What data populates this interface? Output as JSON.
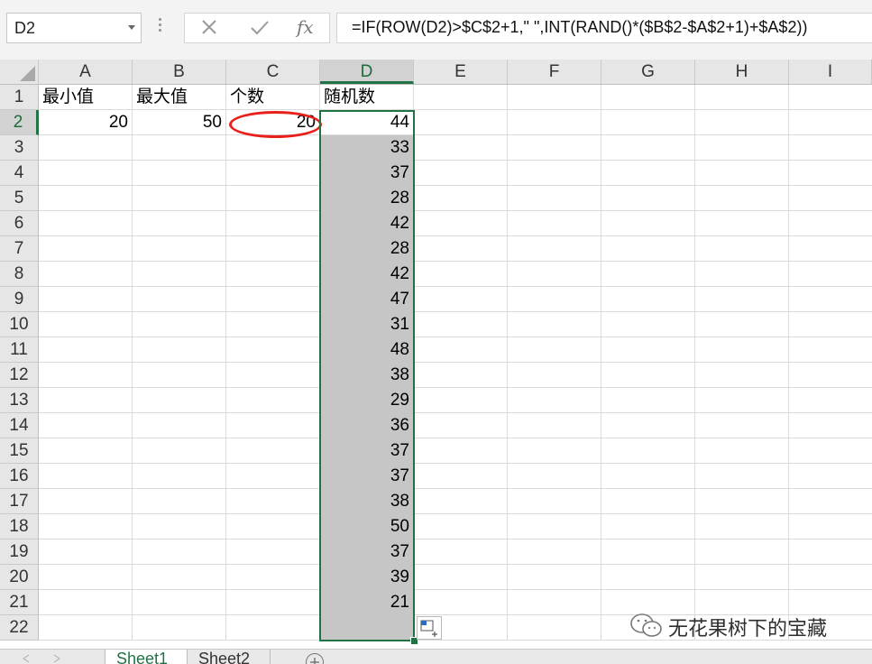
{
  "formula_bar": {
    "name_box": "D2",
    "formula": "=IF(ROW(D2)>$C$2+1,\" \",INT(RAND()*($B$2-$A$2+1)+$A$2))",
    "cancel_icon": "close-icon",
    "enter_icon": "checkmark-icon",
    "fx_label": "fx"
  },
  "columns": [
    "A",
    "B",
    "C",
    "D",
    "E",
    "F",
    "G",
    "H",
    "I"
  ],
  "rows": [
    "1",
    "2",
    "3",
    "4",
    "5",
    "6",
    "7",
    "8",
    "9",
    "10",
    "11",
    "12",
    "13",
    "14",
    "15",
    "16",
    "17",
    "18",
    "19",
    "20",
    "21",
    "22"
  ],
  "active_column": "D",
  "active_row": "2",
  "headers": {
    "A1": "最小值",
    "B1": "最大值",
    "C1": "个数",
    "D1": "随机数"
  },
  "values": {
    "A2": "20",
    "B2": "50",
    "C2": "20"
  },
  "random_numbers": [
    "44",
    "33",
    "37",
    "28",
    "42",
    "28",
    "42",
    "47",
    "31",
    "48",
    "38",
    "29",
    "36",
    "37",
    "37",
    "38",
    "50",
    "37",
    "39",
    "21",
    ""
  ],
  "sheet_tabs": [
    "Sheet1",
    "Sheet2"
  ],
  "active_sheet": "Sheet1",
  "watermark": {
    "text": "无花果树下的宝藏",
    "icon": "wechat-icon"
  },
  "colors": {
    "accent": "#217346",
    "highlight": "#e8201a",
    "selection": "#c6c6c6"
  }
}
